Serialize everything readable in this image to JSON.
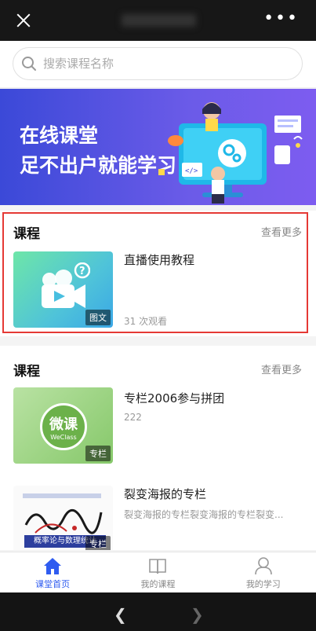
{
  "search": {
    "placeholder": "搜索课程名称"
  },
  "banner": {
    "line1": "在线课堂",
    "line2": "足不出户就能学习"
  },
  "sections": [
    {
      "title": "课程",
      "more": "查看更多",
      "items": [
        {
          "title": "直播使用教程",
          "subtitle": "31 次观看",
          "tag": "图文"
        }
      ]
    },
    {
      "title": "课程",
      "more": "查看更多",
      "items": [
        {
          "title": "专栏2006参与拼团",
          "subtitle": "222",
          "tag": "专栏",
          "thumb_text": "微课",
          "thumb_subtext": "WeClass"
        },
        {
          "title": "裂变海报的专栏",
          "subtitle": "裂变海报的专栏裂变海报的专栏裂变...",
          "tag": "专栏",
          "thumb_text": "概率论与数理统计"
        }
      ]
    }
  ],
  "tabs": [
    {
      "label": "课堂首页",
      "icon": "home-icon",
      "active": true
    },
    {
      "label": "我的课程",
      "icon": "book-icon",
      "active": false
    },
    {
      "label": "我的学习",
      "icon": "user-icon",
      "active": false
    }
  ],
  "colors": {
    "accent": "#2f5cf0",
    "highlight": "#e53935",
    "banner_start": "#3b49d8",
    "banner_end": "#7d5cf0"
  }
}
